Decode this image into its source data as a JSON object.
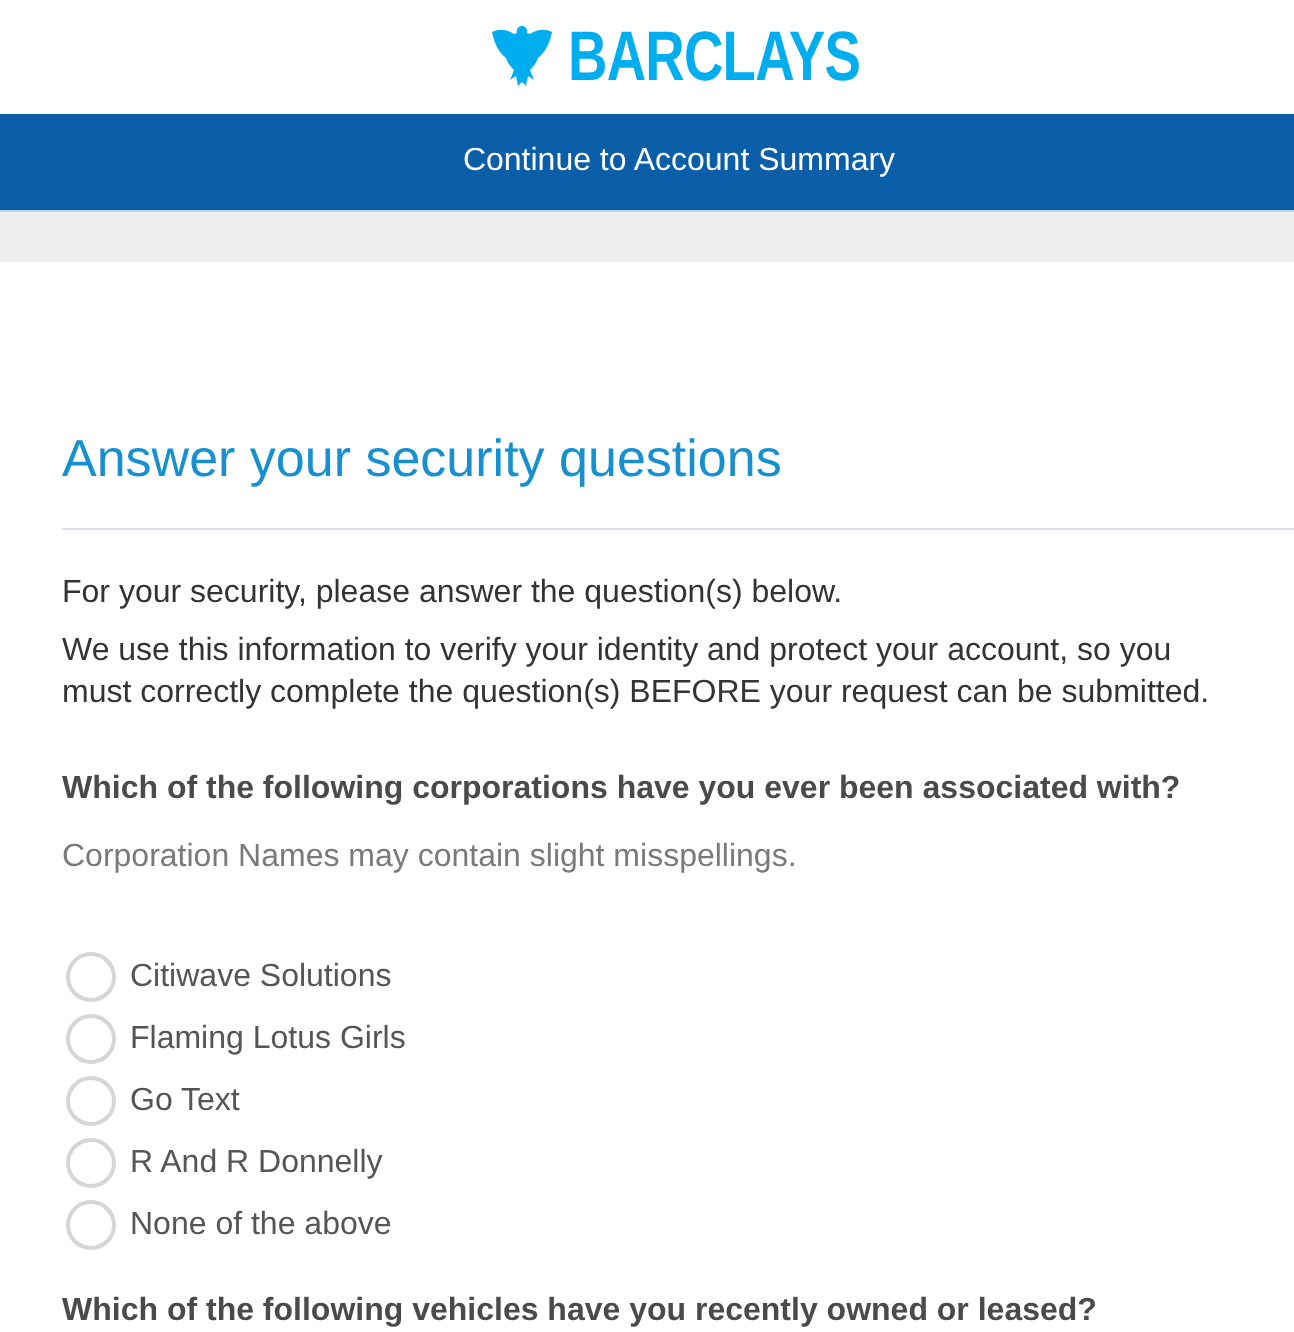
{
  "header": {
    "logo_text": "BARCLAYS"
  },
  "nav_bar": {
    "link": "Continue to Account Summary"
  },
  "page": {
    "title": "Answer your security questions",
    "intro": "For your security, please answer the question(s) below.",
    "explanation": "We use this information to verify your identity and protect your account, so you must correctly complete the question(s) BEFORE your request can be submitted."
  },
  "questions": [
    {
      "text": "Which of the following corporations have you ever been associated with?",
      "hint": "Corporation Names may contain slight misspellings.",
      "options": [
        {
          "label": "Citiwave Solutions",
          "selected": false
        },
        {
          "label": "Flaming Lotus Girls",
          "selected": false
        },
        {
          "label": "Go Text",
          "selected": false
        },
        {
          "label": "R And R Donnelly",
          "selected": false
        },
        {
          "label": "None of the above",
          "selected": false
        }
      ]
    },
    {
      "text": "Which of the following vehicles have you recently owned or leased?"
    }
  ]
}
